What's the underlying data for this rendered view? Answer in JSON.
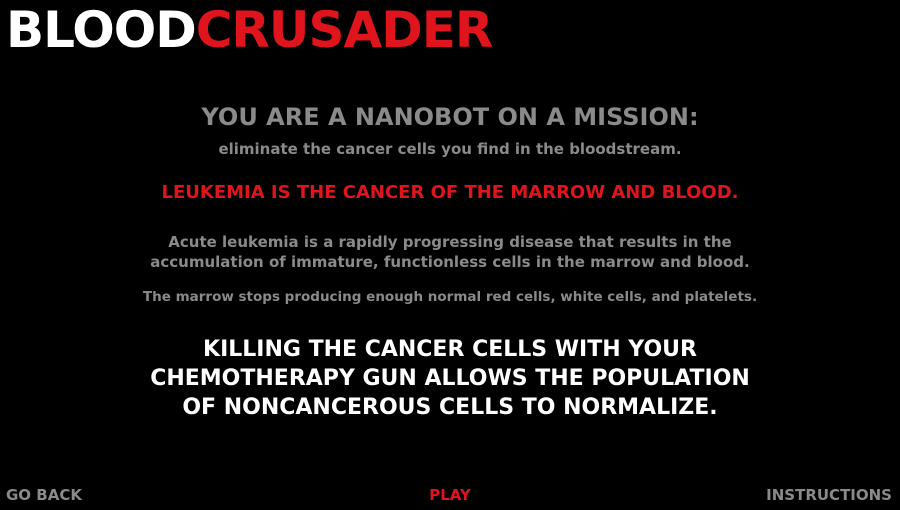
{
  "title": {
    "part1": "BLOOD",
    "part2": "CRUSADER",
    "colors": {
      "part1": "#ffffff",
      "part2": "#e0141c"
    }
  },
  "intro": {
    "heading": "YOU ARE A NANOBOT ON A MISSION:",
    "subheading": "eliminate the cancer cells you find in the bloodstream."
  },
  "leukemia": {
    "heading": "LEUKEMIA IS THE CANCER OF THE MARROW AND BLOOD.",
    "acute_line1": "Acute leukemia is a rapidly progressing disease that results in the",
    "acute_line2": "accumulation of immature, functionless cells in the marrow and blood.",
    "marrow_text": "The marrow stops producing enough normal red cells, white cells, and platelets."
  },
  "mission": {
    "line1": "KILLING THE CANCER CELLS WITH YOUR",
    "line2": "CHEMOTHERAPY GUN ALLOWS THE POPULATION",
    "line3": "OF NONCANCEROUS CELLS TO NORMALIZE."
  },
  "nav": {
    "back": "GO BACK",
    "play": "PLAY",
    "instructions": "INSTRUCTIONS"
  },
  "colors": {
    "background": "#000000",
    "accent_red": "#e0141c",
    "gray_text": "#8a8a8a",
    "white_text": "#ffffff"
  }
}
